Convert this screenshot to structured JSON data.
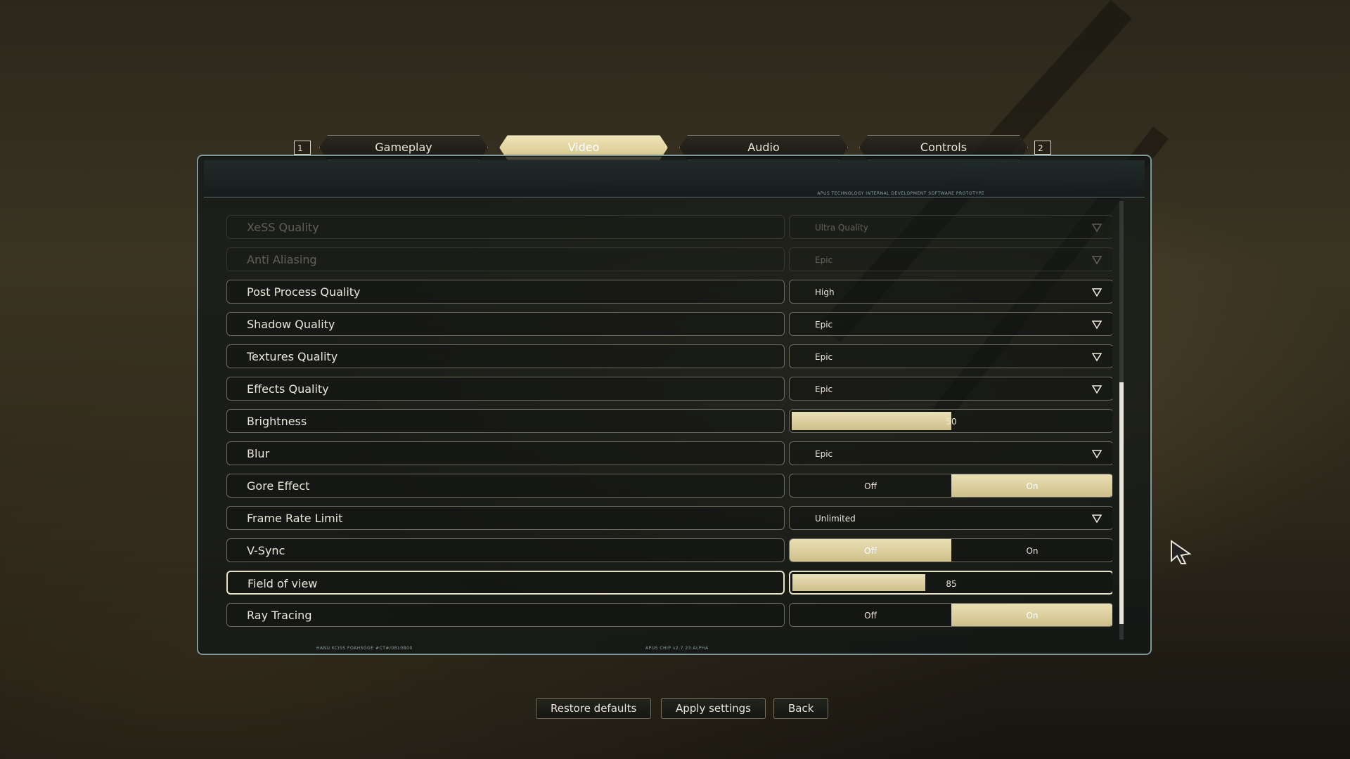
{
  "tabs": {
    "prev_key": "1",
    "next_key": "2",
    "items": [
      {
        "label": "Gameplay",
        "active": false
      },
      {
        "label": "Video",
        "active": true
      },
      {
        "label": "Audio",
        "active": false
      },
      {
        "label": "Controls",
        "active": false
      }
    ]
  },
  "panel": {
    "header_note": "APUS TECHNOLOGY INTERNAL DEVELOPMENT SOFTWARE PROTOTYPE",
    "footer_left": "HANU KCISS FOAHSGGE #CT#/0BL0B00",
    "footer_center": "APUS CHIP v2.7.23.ALPHA"
  },
  "settings": [
    {
      "label": "XeSS Quality",
      "type": "dropdown",
      "value": "Ultra Quality",
      "disabled": true
    },
    {
      "label": "Anti Aliasing",
      "type": "dropdown",
      "value": "Epic",
      "disabled": true
    },
    {
      "label": "Post Process Quality",
      "type": "dropdown",
      "value": "High"
    },
    {
      "label": "Shadow Quality",
      "type": "dropdown",
      "value": "Epic"
    },
    {
      "label": "Textures Quality",
      "type": "dropdown",
      "value": "Epic"
    },
    {
      "label": "Effects Quality",
      "type": "dropdown",
      "value": "Epic"
    },
    {
      "label": "Brightness",
      "type": "slider",
      "value": "50",
      "fill": 0.5
    },
    {
      "label": "Blur",
      "type": "dropdown",
      "value": "Epic"
    },
    {
      "label": "Gore Effect",
      "type": "toggle",
      "off_label": "Off",
      "on_label": "On",
      "state": "On"
    },
    {
      "label": "Frame Rate Limit",
      "type": "dropdown",
      "value": "Unlimited"
    },
    {
      "label": "V-Sync",
      "type": "toggle",
      "off_label": "Off",
      "on_label": "On",
      "state": "Off"
    },
    {
      "label": "Field of view",
      "type": "slider",
      "value": "85",
      "fill": 0.42,
      "selected": true
    },
    {
      "label": "Ray Tracing",
      "type": "toggle",
      "off_label": "Off",
      "on_label": "On",
      "state": "On"
    }
  ],
  "scroll": {
    "position": 0.92,
    "thumb_fraction": 0.55
  },
  "actions": {
    "restore_defaults": "Restore defaults",
    "apply_settings": "Apply settings",
    "back": "Back"
  },
  "colors": {
    "accent": "#d8ca92",
    "panel_border": "#7f9a9a"
  }
}
